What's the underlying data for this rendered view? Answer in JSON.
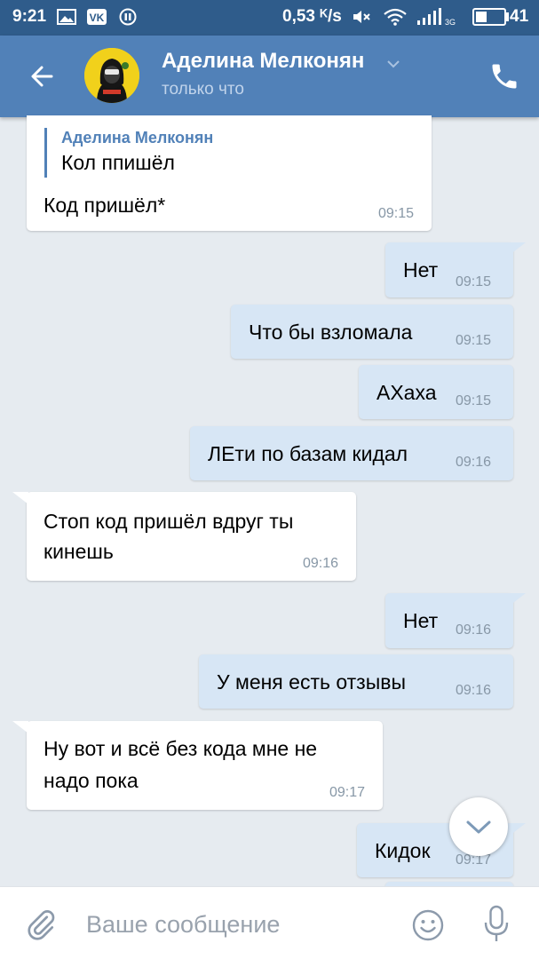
{
  "status_bar": {
    "time": "9:21",
    "network_speed": "0,53 ᴷ/s",
    "battery_level": "41",
    "battery_fraction": 0.41,
    "icons": [
      "gallery-icon",
      "vk-icon",
      "pause-icon",
      "mute-icon",
      "wifi-icon",
      "signal-icon"
    ]
  },
  "header": {
    "contact_name": "Аделина Мелконян",
    "status": "только что",
    "icons": [
      "back-arrow-icon",
      "chevron-down-icon",
      "phone-icon"
    ]
  },
  "messages": [
    {
      "dir": "in",
      "quote_author": "Аделина Мелконян",
      "quote_text": "Кол ппишёл",
      "text": "Код пришёл*",
      "time": "09:15"
    },
    {
      "dir": "out",
      "text": "Нет",
      "time": "09:15"
    },
    {
      "dir": "out",
      "text": "Что бы взломала",
      "time": "09:15"
    },
    {
      "dir": "out",
      "text": "АХаха",
      "time": "09:15"
    },
    {
      "dir": "out",
      "text": "ЛЕти по базам кидал",
      "time": "09:16"
    },
    {
      "dir": "in",
      "lines": [
        "Стоп код пришёл вдруг ты",
        "кинешь"
      ],
      "time": "09:16"
    },
    {
      "dir": "out",
      "text": "Нет",
      "time": "09:16"
    },
    {
      "dir": "out",
      "text": "У меня есть отзывы",
      "time": "09:16"
    },
    {
      "dir": "in",
      "lines": [
        "Ну вот и всё без кода мне не",
        "надо пока"
      ],
      "time": "09:17"
    },
    {
      "dir": "out",
      "text": "Кидок",
      "time": "09:17"
    }
  ],
  "composer": {
    "placeholder": "Ваше сообщение",
    "icons": [
      "paperclip-icon",
      "emoji-icon",
      "microphone-icon"
    ]
  },
  "colors": {
    "header": "#5181b8",
    "status_bar": "#2f5c8b",
    "background": "#e6ebf0",
    "incoming_bubble": "#ffffff",
    "outgoing_bubble": "#d7e6f5"
  }
}
